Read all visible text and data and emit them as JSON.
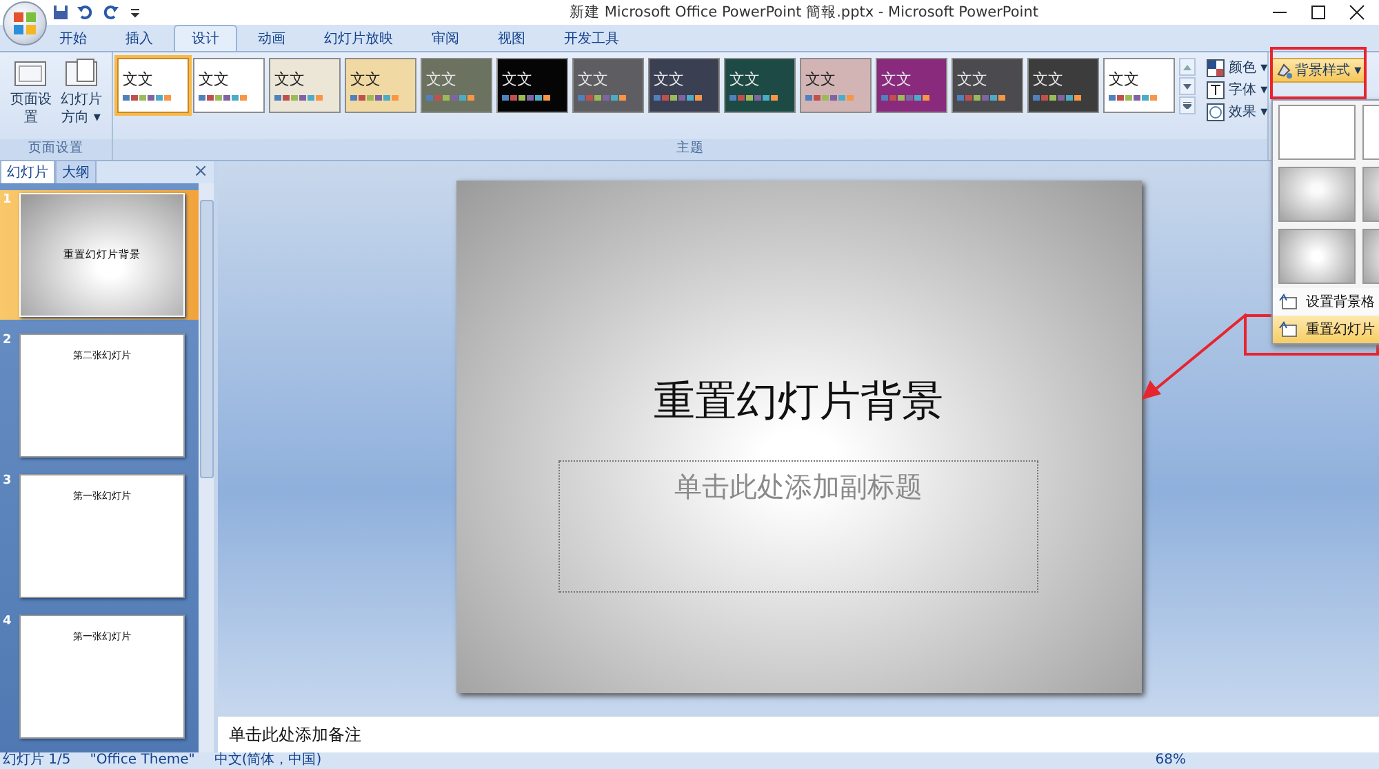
{
  "window": {
    "title": "新建 Microsoft Office PowerPoint 簡報.pptx - Microsoft PowerPoint"
  },
  "tabs": [
    {
      "label": "开始",
      "selected": false
    },
    {
      "label": "插入",
      "selected": false
    },
    {
      "label": "设计",
      "selected": true
    },
    {
      "label": "动画",
      "selected": false
    },
    {
      "label": "幻灯片放映",
      "selected": false
    },
    {
      "label": "审阅",
      "selected": false
    },
    {
      "label": "视图",
      "selected": false
    },
    {
      "label": "开发工具",
      "selected": false
    }
  ],
  "page_setup_group": {
    "buttons": [
      {
        "label": "页面设置"
      },
      {
        "label": "幻灯片方向 ▾"
      }
    ],
    "group_label": "页面设置"
  },
  "themes_group": {
    "themes": [
      {
        "label": "文文",
        "color": "#ffffff",
        "selected": true
      },
      {
        "label": "文文",
        "color": "#ffffff",
        "selected": false
      },
      {
        "label": "文文",
        "color": "#ece6d6",
        "selected": false
      },
      {
        "label": "文文",
        "color": "#f1d9a3",
        "selected": false
      },
      {
        "label": "文文",
        "color": "#6c7260",
        "selected": false
      },
      {
        "label": "文文",
        "color": "#050505",
        "selected": false
      },
      {
        "label": "文文",
        "color": "#5e5e62",
        "selected": false
      },
      {
        "label": "文文",
        "color": "#3b3f52",
        "selected": false
      },
      {
        "label": "文文",
        "color": "#1d4a44",
        "selected": false
      },
      {
        "label": "文文",
        "color": "#d3b4b4",
        "selected": false
      },
      {
        "label": "文文",
        "color": "#8a2a7d",
        "selected": false
      },
      {
        "label": "文文",
        "color": "#4b4b4f",
        "selected": false
      },
      {
        "label": "文文",
        "color": "#3c3c3c",
        "selected": false
      },
      {
        "label": "文文",
        "color": "#ffffff",
        "selected": false
      }
    ],
    "options": [
      {
        "label": "颜色 ▾"
      },
      {
        "label": "字体 ▾"
      },
      {
        "label": "效果 ▾"
      }
    ],
    "group_label": "主题"
  },
  "background_button": {
    "label": "背景样式 ▾"
  },
  "background_menu": {
    "styles": [
      {
        "kind": "plain"
      },
      {
        "kind": "plain"
      },
      {
        "kind": "edge"
      },
      {
        "kind": "edge"
      },
      {
        "kind": "radial"
      },
      {
        "kind": "radial"
      }
    ],
    "items": [
      {
        "label": "设置背景格",
        "selected": false
      },
      {
        "label": "重置幻灯片",
        "selected": true
      }
    ]
  },
  "slides_pane": {
    "tabs": [
      {
        "label": "幻灯片",
        "selected": true
      },
      {
        "label": "大纲",
        "selected": false
      }
    ],
    "close": "×",
    "slides": [
      {
        "number": "1",
        "text": "重置幻灯片背景",
        "selected": true,
        "kind": "gradient"
      },
      {
        "number": "2",
        "text": "第二张幻灯片",
        "selected": false,
        "kind": "plain"
      },
      {
        "number": "3",
        "text": "第一张幻灯片",
        "selected": false,
        "kind": "plain"
      },
      {
        "number": "4",
        "text": "第一张幻灯片",
        "selected": false,
        "kind": "plain"
      }
    ]
  },
  "slide": {
    "title": "重置幻灯片背景",
    "subtitle_placeholder": "单击此处添加副标题"
  },
  "notes": {
    "placeholder": "单击此处添加备注"
  },
  "status_bar": {
    "slide": "幻灯片 1/5",
    "theme": "\"Office Theme\"",
    "language": "中文(简体，中国)",
    "zoom": "68%"
  }
}
